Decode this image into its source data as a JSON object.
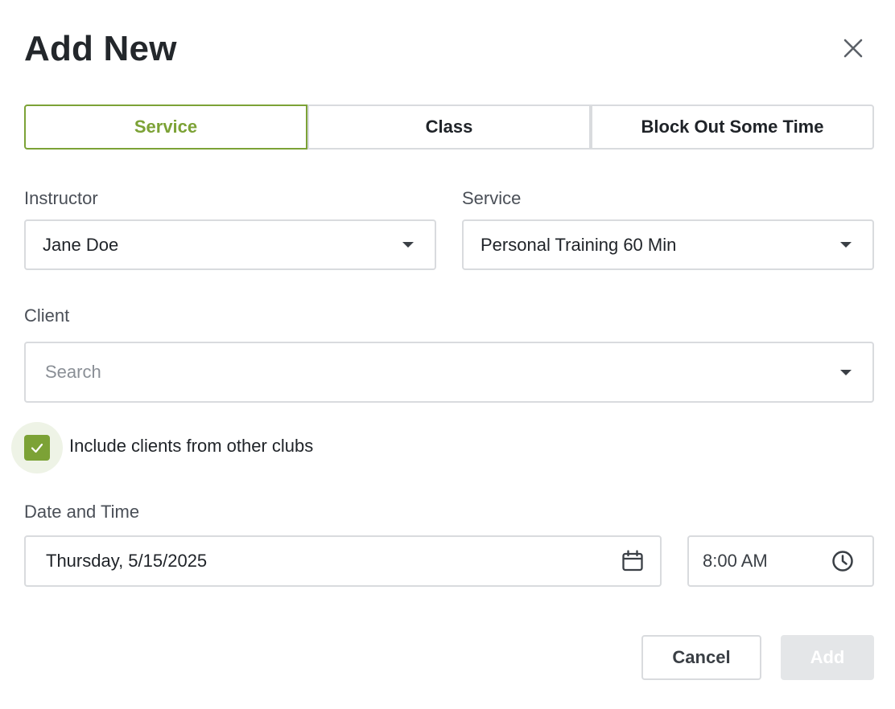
{
  "dialog": {
    "title": "Add New",
    "close_icon": "close-icon"
  },
  "tabs": [
    {
      "label": "Service",
      "active": true
    },
    {
      "label": "Class",
      "active": false
    },
    {
      "label": "Block Out Some Time",
      "active": false
    }
  ],
  "form": {
    "instructor": {
      "label": "Instructor",
      "value": "Jane Doe"
    },
    "service": {
      "label": "Service",
      "value": "Personal Training 60 Min"
    },
    "client": {
      "label": "Client",
      "placeholder": "Search"
    },
    "include_other_clubs": {
      "label": "Include clients from other clubs",
      "checked": true
    },
    "date_time": {
      "label": "Date and Time",
      "date": "Thursday, 5/15/2025",
      "time": "8:00 AM"
    }
  },
  "actions": {
    "cancel_label": "Cancel",
    "add_label": "Add",
    "add_enabled": false
  },
  "colors": {
    "accent": "#7ca236",
    "border": "#d9dbde",
    "disabled_button": "#e4e6e8"
  }
}
